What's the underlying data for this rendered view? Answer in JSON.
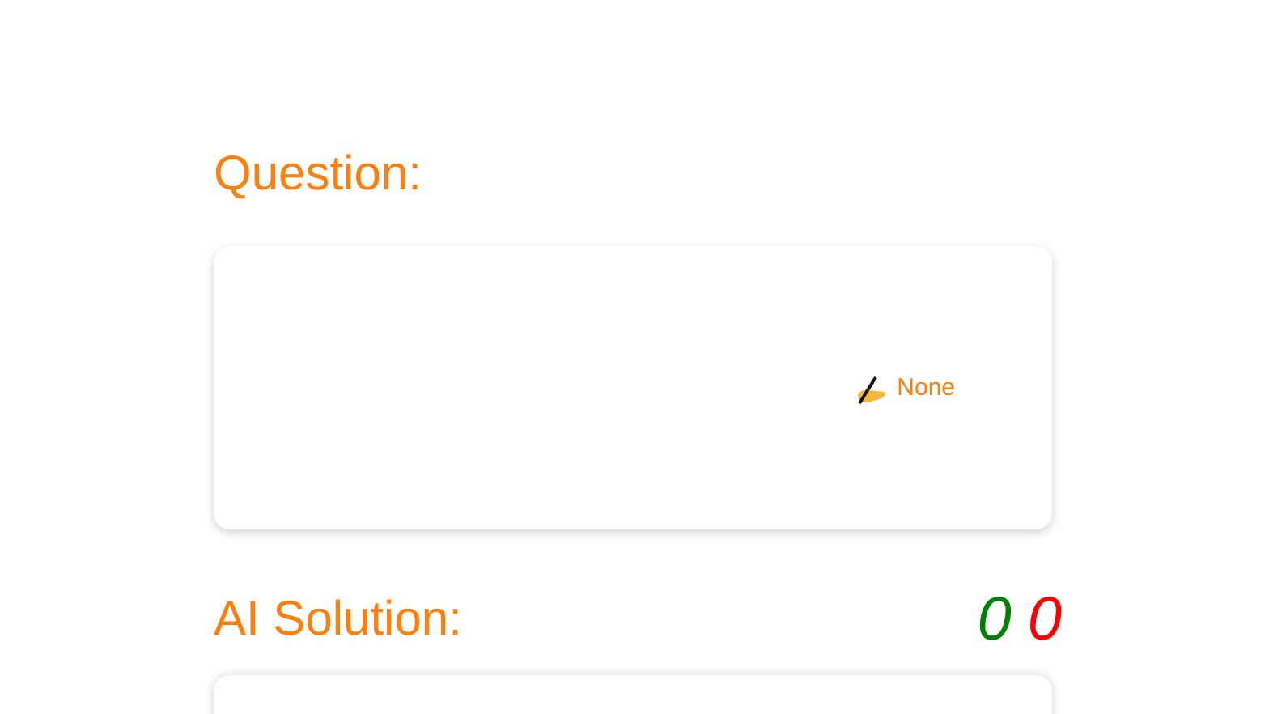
{
  "question": {
    "heading": "Question:",
    "answer_text": "None"
  },
  "solution": {
    "heading": "AI Solution:",
    "scores": [
      {
        "value": "0",
        "color": "#008000"
      },
      {
        "value": "0",
        "color": "#ff0000"
      }
    ]
  }
}
